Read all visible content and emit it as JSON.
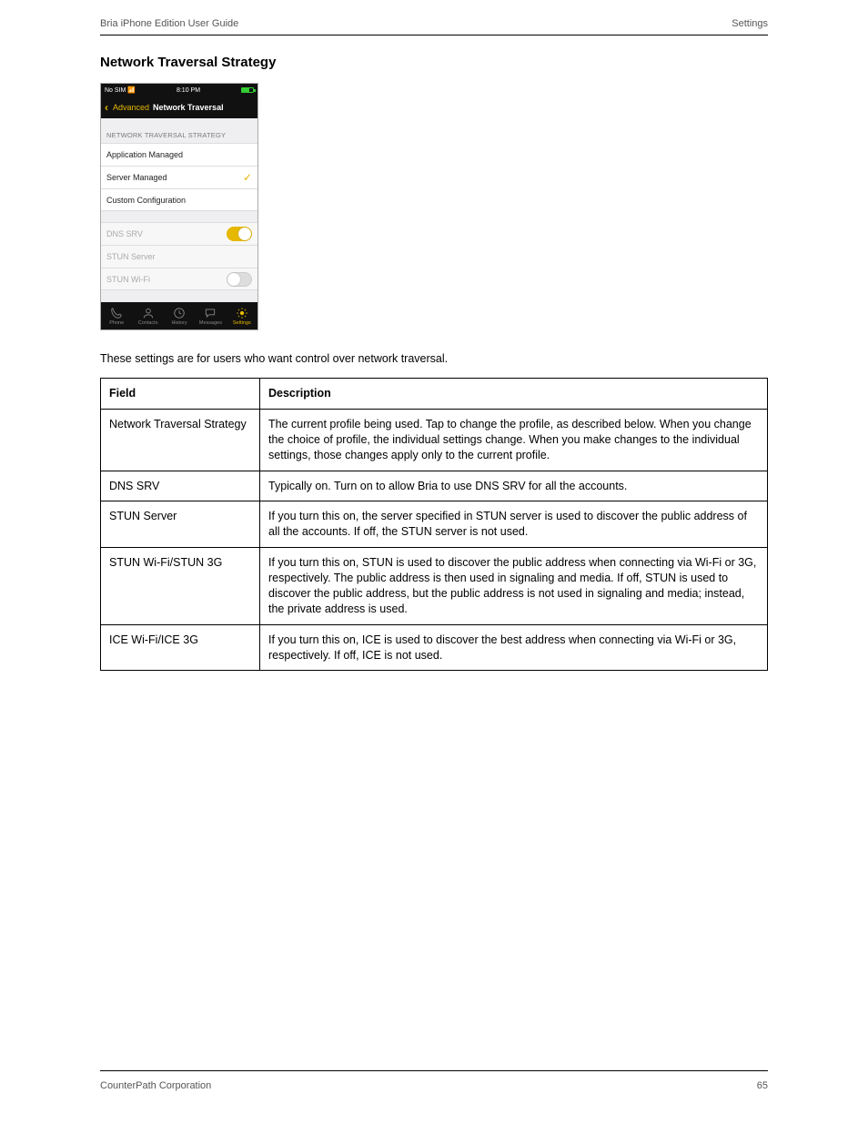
{
  "header": {
    "left": "Bria iPhone Edition User Guide",
    "right": "Settings"
  },
  "section_title": "Network Traversal Strategy",
  "phone": {
    "status": {
      "left": "No SIM",
      "center": "8:10 PM"
    },
    "nav": {
      "back": "Advanced",
      "title": "Network Traversal"
    },
    "group_header": "NETWORK TRAVERSAL STRATEGY",
    "rows": {
      "app_managed": "Application Managed",
      "server_managed": "Server Managed",
      "custom": "Custom Configuration",
      "dns_srv": "DNS SRV",
      "stun_server": "STUN Server",
      "stun_wifi": "STUN Wi-Fi"
    },
    "tabs": [
      "Phone",
      "Contacts",
      "History",
      "Messages",
      "Settings"
    ]
  },
  "intro": "These settings are for users who want control over network traversal.",
  "table": {
    "head": [
      "Field",
      "Description"
    ],
    "rows": [
      {
        "field": "Network Traversal Strategy",
        "desc": "The current profile being used. Tap to change the profile, as described below. When you change the choice of profile, the individual settings change. When you make changes to the individual settings, those changes apply only to the current profile."
      },
      {
        "field": "DNS SRV",
        "desc": "Typically on. Turn on to allow Bria to use DNS SRV for all the accounts."
      },
      {
        "field": "STUN Server",
        "desc": "If you turn this on, the server specified in STUN server is used to discover the public address of all the accounts. If off, the STUN server is not used."
      },
      {
        "field": "STUN Wi-Fi/STUN 3G",
        "desc": "If you turn this on, STUN is used to discover the public address when connecting via Wi-Fi or 3G, respectively. The public address is then used in signaling and media. If off, STUN is used to discover the public address, but the public address is not used in signaling and media; instead, the private address is used."
      },
      {
        "field": "ICE Wi-Fi/ICE 3G",
        "desc": "If you turn this on, ICE is used to discover the best address when connecting via Wi-Fi or 3G, respectively. If off, ICE is not used."
      }
    ]
  },
  "footer": {
    "left": "CounterPath Corporation",
    "right": "65"
  }
}
